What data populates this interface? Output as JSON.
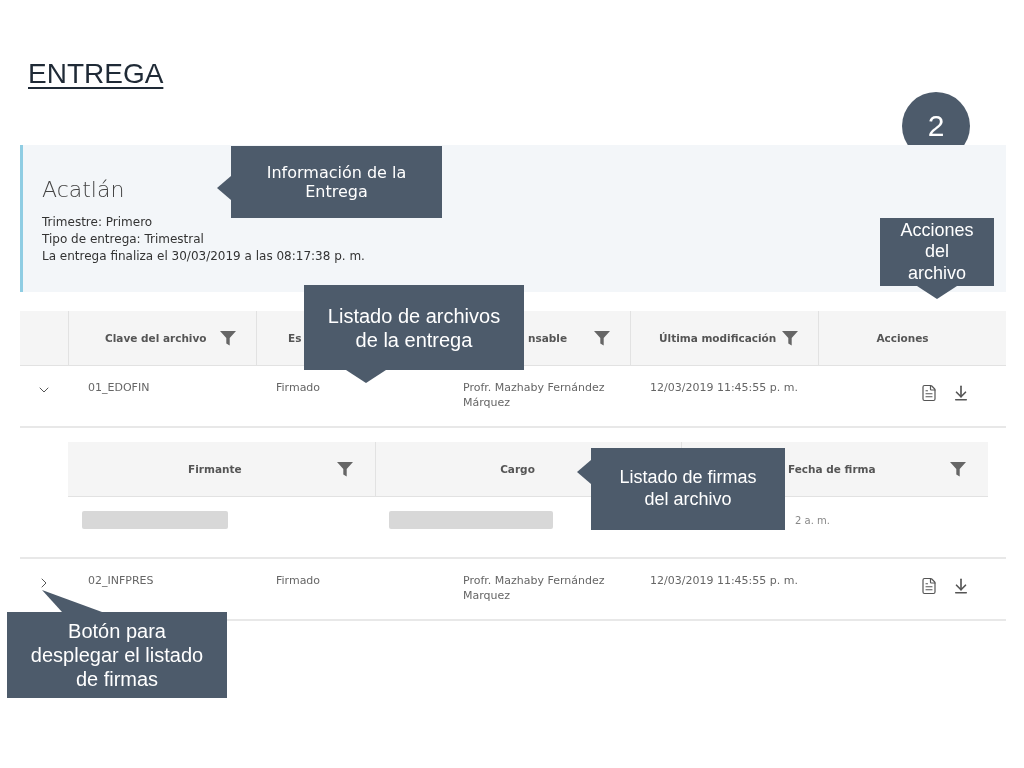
{
  "slide": {
    "title": "ENTREGA",
    "page_number": "2"
  },
  "delivery_info": {
    "campus": "Acatlán",
    "lines": [
      "Trimestre: Primero",
      "Tipo de entrega: Trimestral",
      "La entrega finaliza el 30/03/2019 a las 08:17:38 p. m."
    ]
  },
  "files_table": {
    "columns": [
      {
        "label": "Clave del archivo",
        "filterable": true
      },
      {
        "label": "Es",
        "filterable": false
      },
      {
        "label": "nsable",
        "filterable": true
      },
      {
        "label": "Última modificación",
        "filterable": true
      },
      {
        "label": "Acciones",
        "filterable": false
      }
    ],
    "rows": [
      {
        "expanded": true,
        "clave": "01_EDOFIN",
        "estatus": "Firmado",
        "responsable": "Profr. Mazhaby Fernández Márquez",
        "modified": "12/03/2019 11:45:55 p. m.",
        "signatures": {
          "columns": [
            {
              "label": "Firmante",
              "filterable": true
            },
            {
              "label": "Cargo",
              "filterable": false
            },
            {
              "label": "Fecha de firma",
              "filterable": true
            }
          ],
          "rows": [
            {
              "cells": [
                {
                  "kind": "redacted"
                },
                {
                  "kind": "redacted"
                },
                {
                  "kind": "text",
                  "text": "2 a. m."
                }
              ]
            }
          ]
        }
      },
      {
        "expanded": false,
        "clave": "02_INFPRES",
        "estatus": "Firmado",
        "responsable": "Profr. Mazhaby Fernández Marquez",
        "modified": "12/03/2019 11:45:55 p. m."
      }
    ]
  },
  "callouts": [
    {
      "text": "Información de la Entrega",
      "kind": "left"
    },
    {
      "text": "Acciones del archivo",
      "kind": "down"
    },
    {
      "text": "Listado de archivos de la entrega",
      "kind": "down"
    },
    {
      "text": "Listado de firmas del archivo",
      "kind": "left"
    },
    {
      "text": "Botón para desplegar el listado de firmas",
      "kind": "up"
    }
  ]
}
